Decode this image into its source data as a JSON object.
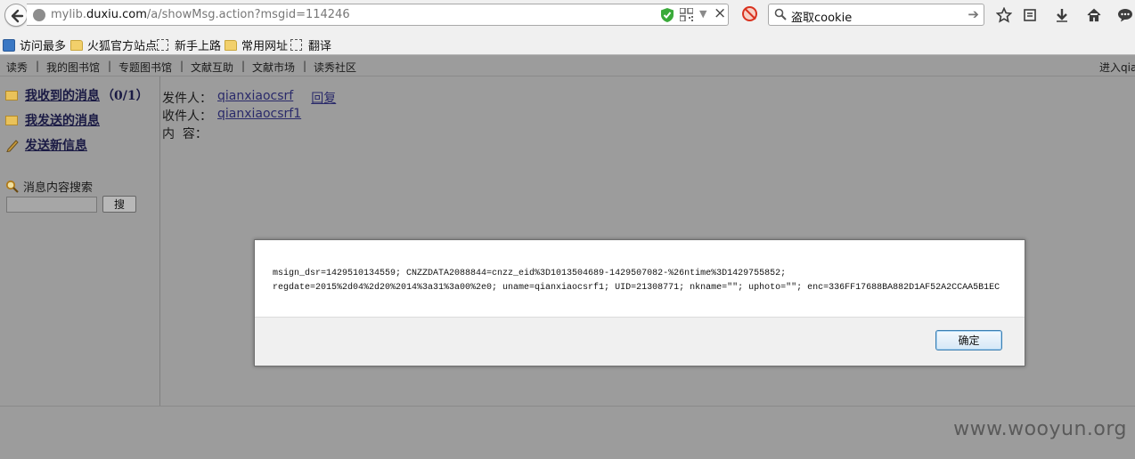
{
  "browser": {
    "url_domain_pre": "mylib.",
    "url_domain": "duxiu.com",
    "url_path": "/a/showMsg.action?msgid=114246",
    "search_query": "盗取cookie"
  },
  "bookmarks": [
    {
      "label": "访问最多"
    },
    {
      "label": "火狐官方站点"
    },
    {
      "label": "新手上路"
    },
    {
      "label": "常用网址"
    },
    {
      "label": "翻译"
    }
  ],
  "site_nav": {
    "items": [
      "读秀",
      "我的图书馆",
      "专题图书馆",
      "文献互助",
      "文献市场",
      "读秀社区"
    ],
    "separator": "|",
    "right_text": "进入qia"
  },
  "sidebar": {
    "inbox_label": "我收到的消息",
    "inbox_count": "（0/1）",
    "sent_label": "我发送的消息",
    "compose_label": "发送新信息",
    "search_label": "消息内容搜索",
    "search_button": "搜"
  },
  "message": {
    "sender_label": "发件人：",
    "sender": "qianxiaocsrf",
    "reply_label": "回复",
    "recipient_label": "收件人：",
    "recipient": "qianxiaocsrf1",
    "content_label": "内  容："
  },
  "dialog": {
    "line1": "msign_dsr=1429510134559; CNZZDATA2088844=cnzz_eid%3D1013504689-1429507082-%26ntime%3D1429755852;",
    "line2": "regdate=2015%2d04%2d20%2014%3a31%3a00%2e0; uname=qianxiaocsrf1; UID=21308771; nkname=\"\"; uphoto=\"\"; enc=336FF17688BA882D1AF52A2CCAA5B1EC",
    "ok_label": "确定"
  },
  "watermark": "www.wooyun.org"
}
